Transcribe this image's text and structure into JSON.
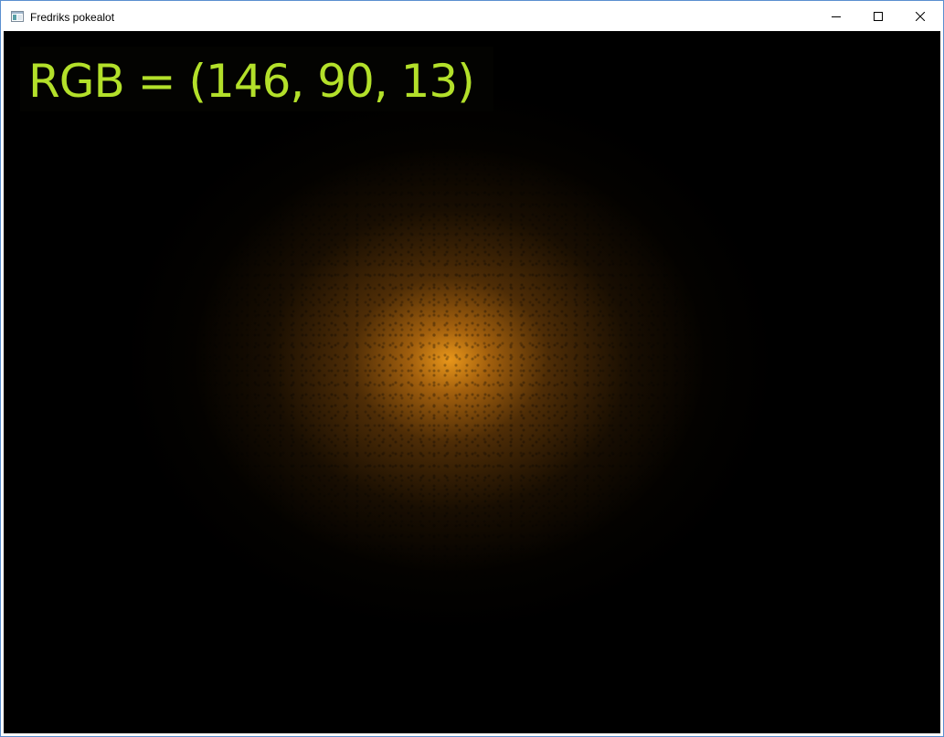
{
  "window": {
    "title": "Fredriks pokealot",
    "app_icon": "window-app-icon",
    "controls": {
      "minimize_icon": "minimize-icon",
      "maximize_icon": "maximize-icon",
      "close_icon": "close-icon"
    }
  },
  "canvas": {
    "readout_text": "RGB = (146, 90, 13)",
    "readout_color": "#b3e02a",
    "glow_color": "#e8961a",
    "background_color": "#000000"
  }
}
